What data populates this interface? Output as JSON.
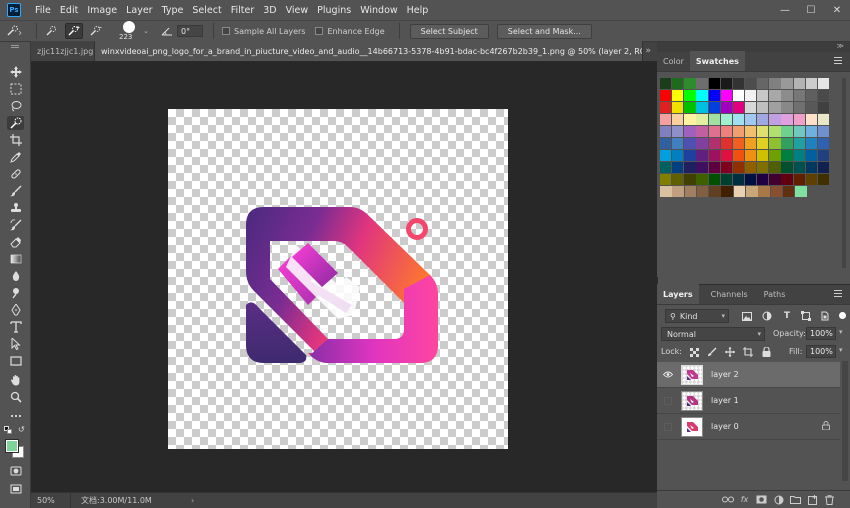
{
  "app": {
    "logo_text": "Ps",
    "menu": [
      "File",
      "Edit",
      "Image",
      "Layer",
      "Type",
      "Select",
      "Filter",
      "3D",
      "View",
      "Plugins",
      "Window",
      "Help"
    ],
    "window_controls": [
      "—",
      "☐",
      "✕"
    ]
  },
  "options_bar": {
    "brush_size": "223",
    "angle": "0°",
    "sample_all_layers": "Sample All Layers",
    "enhance_edge": "Enhance Edge",
    "select_subject": "Select Subject",
    "select_and_mask": "Select and Mask..."
  },
  "colors": {
    "foreground": "#7ed39a",
    "background": "#ffffff",
    "accent": "#31a8ff"
  },
  "tabs": [
    {
      "label": "zjjc11zjjc1.jpg",
      "close": "×",
      "active": false
    },
    {
      "label": "winxvideoai_png_logo_for_a_brand_in_piucture_video_and_audio__14b66713-5378-4b91-bdac-bc4f267b2b39_1.png @ 50% (layer 2, RGB/8) *",
      "close": "×",
      "active": true
    }
  ],
  "tabs_more": "»",
  "status": {
    "zoom": "50%",
    "doc_info": "文档:3.00M/11.0M",
    "arrow": "›"
  },
  "color_panel": {
    "tabs": [
      "Color",
      "Swatches"
    ],
    "swatches": [
      [
        "#1b3d1b",
        "#1e6b1e",
        "#2e8b2e",
        "#6e6e6e",
        "#000000",
        "#1a1a1a",
        "#333333",
        "#4d4d4d",
        "#666666",
        "#808080",
        "#999999",
        "#b3b3b3",
        "#cccccc",
        "#e6e6e6"
      ],
      [
        "#ff0000",
        "#ffff00",
        "#00ff00",
        "#00ffff",
        "#0000ff",
        "#ff00ff",
        "#ffffff",
        "#f2f2f2",
        "#c8c8c8",
        "#a8a8a8",
        "#8c8c8c",
        "#777777",
        "#5f5f5f",
        "#4a4a4a"
      ],
      [
        "#e32020",
        "#f0e000",
        "#00c000",
        "#00c0e0",
        "#0040e0",
        "#a000c0",
        "#e00080",
        "#d8d8d8",
        "#bfbfbf",
        "#a0a0a0",
        "#888888",
        "#707070",
        "#585858",
        "#404040"
      ],
      [
        "#f4a0a0",
        "#fad0a0",
        "#fff2a0",
        "#e0f0a0",
        "#a0e0a0",
        "#a0f0d0",
        "#a0e0f0",
        "#a0c8f0",
        "#a0a8e0",
        "#c0a0e0",
        "#e0a0e0",
        "#f0a0c8",
        "#ffe0c8",
        "#e8e8c8"
      ],
      [
        "#8080c0",
        "#9090c8",
        "#a060c0",
        "#c060a0",
        "#e07090",
        "#f08080",
        "#f0a070",
        "#f0c070",
        "#e0e070",
        "#b0e070",
        "#70d090",
        "#70c8c0",
        "#70b0e0",
        "#7090d0"
      ],
      [
        "#3060a0",
        "#4080c0",
        "#5050b0",
        "#8040a0",
        "#b03070",
        "#e03030",
        "#f06020",
        "#f0a020",
        "#e0d020",
        "#90c030",
        "#30a060",
        "#20a0a0",
        "#2080c0",
        "#3060b0"
      ],
      [
        "#00a0e0",
        "#0080c0",
        "#2040a0",
        "#602080",
        "#a01060",
        "#e01040",
        "#f05010",
        "#f09010",
        "#d0c000",
        "#70a000",
        "#008040",
        "#008080",
        "#0060a0",
        "#204080"
      ],
      [
        "#006060",
        "#004080",
        "#202060",
        "#401060",
        "#600040",
        "#800020",
        "#903000",
        "#906000",
        "#807000",
        "#506000",
        "#005030",
        "#005050",
        "#003860",
        "#102050"
      ],
      [
        "#808000",
        "#606000",
        "#404000",
        "#406000",
        "#005000",
        "#004030",
        "#003040",
        "#001040",
        "#200040",
        "#400030",
        "#600010",
        "#602000",
        "#604000",
        "#403000"
      ],
      [
        "#d8c0a0",
        "#c0a080",
        "#a08060",
        "#806040",
        "#604020",
        "#402000",
        "#e8d0b0",
        "#c8a878",
        "#a87848",
        "#885030",
        "#603010",
        "#80e0a0"
      ]
    ]
  },
  "layers_panel": {
    "tabs": [
      "Layers",
      "Channels",
      "Paths"
    ],
    "kind": "Kind",
    "blend_mode": "Normal",
    "opacity_label": "Opacity:",
    "opacity": "100%",
    "lock_label": "Lock:",
    "fill_label": "Fill:",
    "fill": "100%",
    "layers": [
      {
        "name": "layer 2",
        "visible": true,
        "selected": true,
        "locked": false
      },
      {
        "name": "layer 1",
        "visible": false,
        "selected": false,
        "locked": false
      },
      {
        "name": "layer 0",
        "visible": false,
        "selected": false,
        "locked": true
      }
    ],
    "footer_icons": [
      "link-icon",
      "fx-icon",
      "mask-icon",
      "adjustment-icon",
      "group-icon",
      "new-layer-icon",
      "trash-icon"
    ],
    "footer_fx": "fx"
  }
}
